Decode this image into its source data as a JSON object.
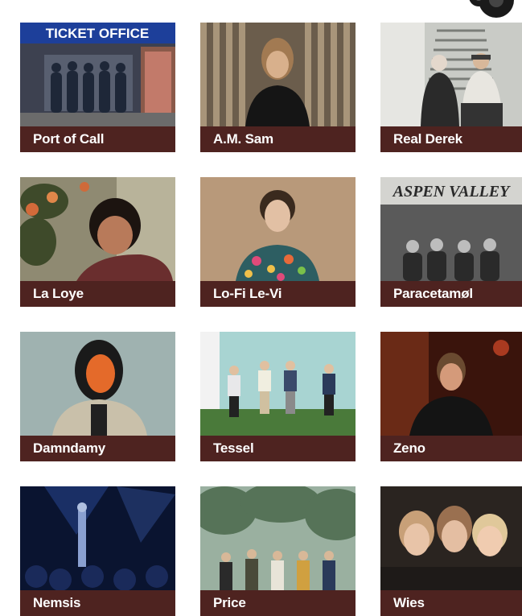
{
  "artists": [
    {
      "name": "Port of Call",
      "photo": "band-at-ticket-office-photo",
      "sign": "TICKET OFFICE"
    },
    {
      "name": "A.M. Sam",
      "photo": "portrait-against-slatted-wall-photo"
    },
    {
      "name": "Real Derek",
      "photo": "duo-on-stairs-photo"
    },
    {
      "name": "La Loye",
      "photo": "portrait-with-flowers-photo"
    },
    {
      "name": "Lo-Fi Le-Vi",
      "photo": "portrait-floral-shirt-photo"
    },
    {
      "name": "Paracetamøl",
      "photo": "band-outside-shop-photo",
      "sign": "ASPEN VALLEY"
    },
    {
      "name": "Damndamy",
      "photo": "masked-hooded-figure-photo"
    },
    {
      "name": "Tessel",
      "photo": "band-on-grass-photo"
    },
    {
      "name": "Zeno",
      "photo": "portrait-night-street-photo"
    },
    {
      "name": "Nemsis",
      "photo": "live-stage-blue-light-photo"
    },
    {
      "name": "Price",
      "photo": "band-under-trees-photo"
    },
    {
      "name": "Wies",
      "photo": "trio-portrait-photo"
    }
  ],
  "colors": {
    "caption_bg": "#4e2320",
    "caption_text": "#ffffff"
  }
}
